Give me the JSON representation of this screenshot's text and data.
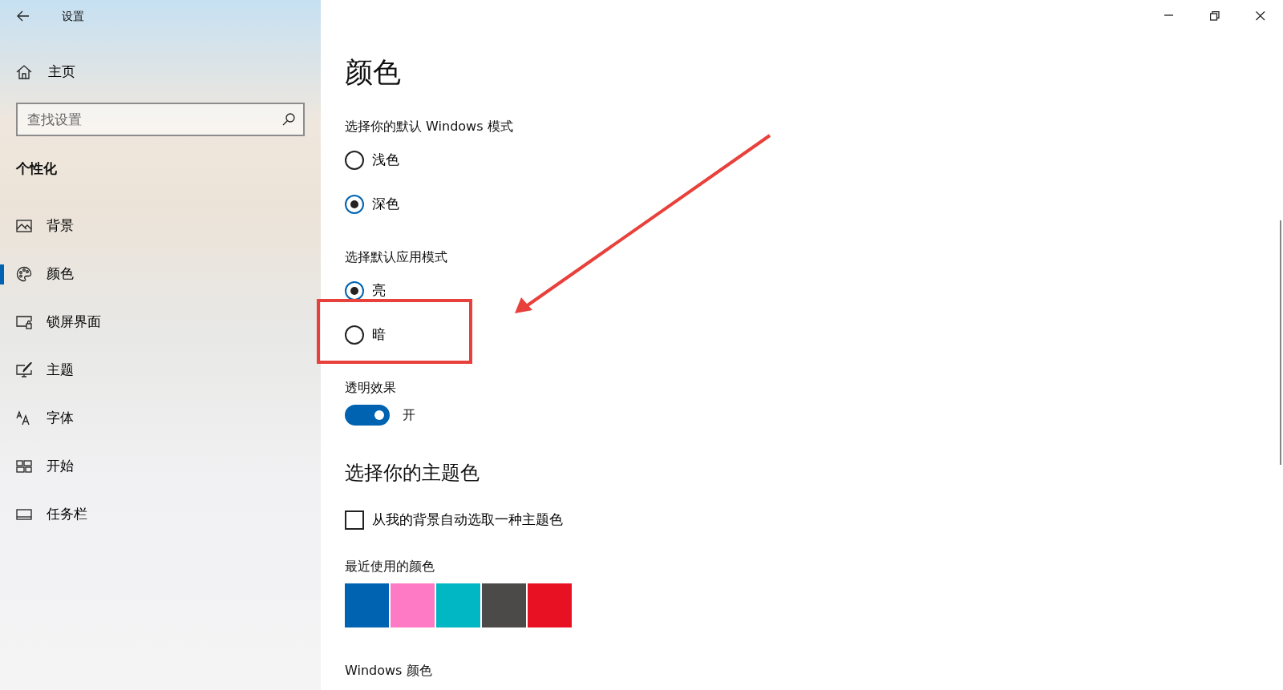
{
  "window": {
    "title": "设置"
  },
  "sidebar": {
    "home": "主页",
    "search": {
      "placeholder": "查找设置"
    },
    "section": "个性化",
    "items": [
      {
        "label": "背景",
        "kind": "background",
        "selected": false
      },
      {
        "label": "颜色",
        "kind": "colors",
        "selected": true
      },
      {
        "label": "锁屏界面",
        "kind": "lockscreen",
        "selected": false
      },
      {
        "label": "主题",
        "kind": "themes",
        "selected": false
      },
      {
        "label": "字体",
        "kind": "fonts",
        "selected": false
      },
      {
        "label": "开始",
        "kind": "start",
        "selected": false
      },
      {
        "label": "任务栏",
        "kind": "taskbar",
        "selected": false
      }
    ]
  },
  "page": {
    "title": "颜色",
    "windows_mode": {
      "label": "选择你的默认 Windows 模式",
      "options": [
        {
          "label": "浅色",
          "selected": false
        },
        {
          "label": "深色",
          "selected": true
        }
      ]
    },
    "app_mode": {
      "label": "选择默认应用模式",
      "options": [
        {
          "label": "亮",
          "selected": true
        },
        {
          "label": "暗",
          "selected": false
        }
      ]
    },
    "transparency": {
      "label": "透明效果",
      "on": true,
      "state_text": "开"
    },
    "accent_heading": "选择你的主题色",
    "auto_pick": {
      "label": "从我的背景自动选取一种主题色",
      "checked": false
    },
    "recent_label": "最近使用的颜色",
    "recent_colors": [
      {
        "color": "#0063b1"
      },
      {
        "color": "#ff7ac4"
      },
      {
        "color": "#00b7c3"
      },
      {
        "color": "#4c4a48"
      },
      {
        "color": "#e81123"
      }
    ],
    "windows_colors_label": "Windows 颜色"
  }
}
